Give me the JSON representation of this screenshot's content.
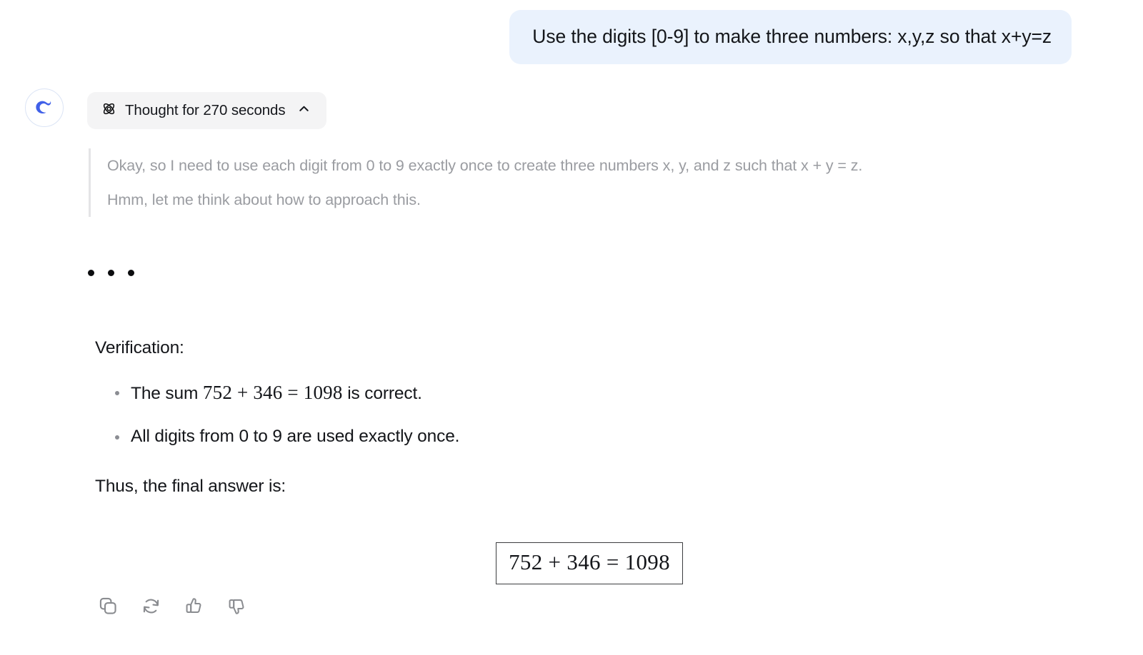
{
  "conversation": {
    "user_message": {
      "text": "Use the digits [0-9] to make three numbers: x,y,z so that x+y=z",
      "bubble_color": "#eaf2fd"
    },
    "assistant": {
      "avatar_name": "deepseek-whale-logo",
      "avatar_color": "#4060e8",
      "thought": {
        "icon": "atom-icon",
        "label": "Thought for 270 seconds",
        "chevron": "chevron-up-icon",
        "pill_color": "#f4f4f5"
      },
      "reasoning": {
        "line1": "Okay, so I need to use each digit from 0 to 9 exactly once to create three numbers x, y, and z such that x + y = z.",
        "line2": "Hmm, let me think about how to approach this."
      },
      "ellipsis": "• • •",
      "answer": {
        "verification_heading": "Verification:",
        "bullets": [
          {
            "prefix": "The sum ",
            "math": "752 + 346 = 1098",
            "suffix": " is correct."
          },
          {
            "prefix": "All digits from 0 to 9 are used exactly once.",
            "math": "",
            "suffix": ""
          }
        ],
        "thus_line": "Thus, the final answer is:",
        "boxed_equation": "752 + 346 = 1098"
      },
      "actions": [
        {
          "name": "copy-icon",
          "label": "Copy"
        },
        {
          "name": "regenerate-icon",
          "label": "Regenerate"
        },
        {
          "name": "thumbs-up-icon",
          "label": "Good response"
        },
        {
          "name": "thumbs-down-icon",
          "label": "Bad response"
        }
      ]
    }
  }
}
